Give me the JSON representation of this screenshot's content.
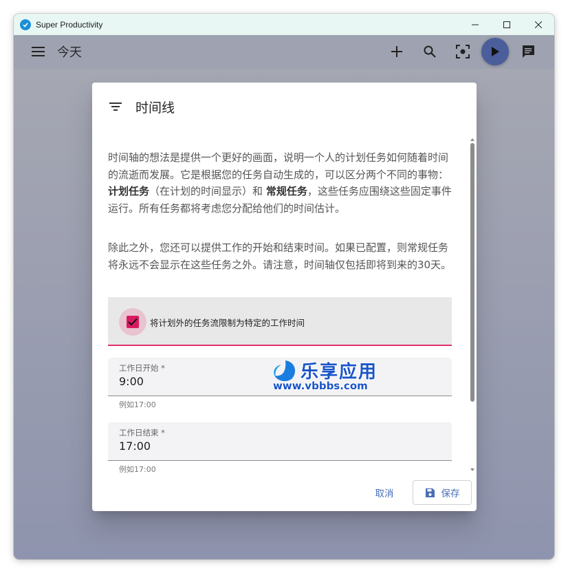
{
  "window": {
    "title": "Super Productivity",
    "accent_color": "#1a8fd8"
  },
  "appbar": {
    "page_title": "今天",
    "play_color": "#4a5e9c"
  },
  "dialog": {
    "title": "时间线",
    "intro_part1": "时间轴的想法是提供一个更好的画面，说明一个人的计划任务如何随着时间的流逝而发展。它是根据您的任务自动生成的，可以区分两个不同的事物：",
    "intro_bold1": "计划任务",
    "intro_part2": "（在计划的时间显示）和",
    "intro_bold2": "常规任务",
    "intro_part3": "，这些任务应围绕这些固定事件运行。所有任务都将考虑您分配给他们的时间估计。",
    "paragraph2": "除此之外，您还可以提供工作的开始和结束时间。如果已配置，则常规任务将永远不会显示在这些任务之外。请注意，时间轴仅包括即将到来的30天。",
    "checkbox": {
      "label": "将计划外的任务流限制为特定的工作时间",
      "checked": true,
      "color": "#d81b60"
    },
    "work_start": {
      "label": "工作日开始 *",
      "value": "9:00",
      "hint": "例如17:00"
    },
    "work_end": {
      "label": "工作日结束 *",
      "value": "17:00",
      "hint": "例如17:00"
    },
    "cancel_label": "取消",
    "save_label": "保存",
    "button_color": "#4a6fb8"
  },
  "watermark": {
    "title": "乐享应用",
    "url": "www.vbbbs.com"
  }
}
